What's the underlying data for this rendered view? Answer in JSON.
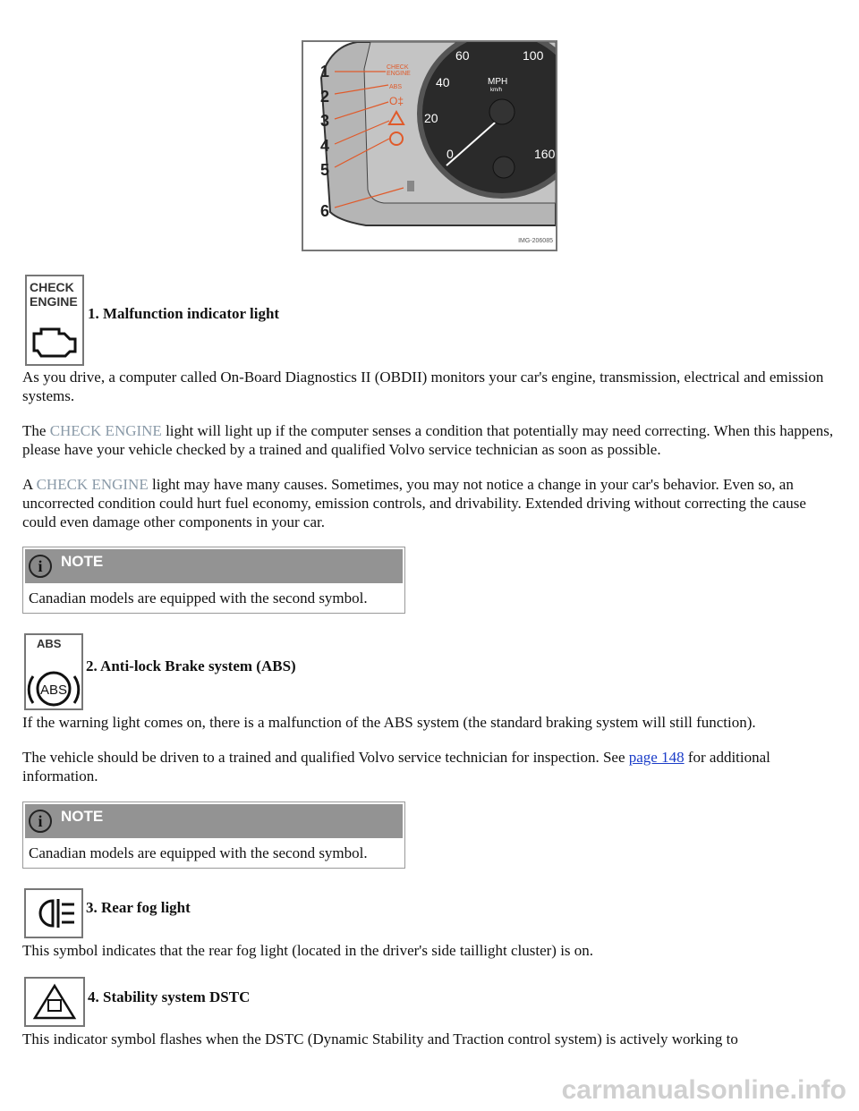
{
  "figure": {
    "callouts": [
      "1",
      "2",
      "3",
      "4",
      "5",
      "6"
    ],
    "image_code": "IMG-206085",
    "gauge_labels": [
      "60",
      "100",
      "40",
      "20",
      "0",
      "160",
      "MPH",
      "km/h"
    ]
  },
  "s1": {
    "icon_text": [
      "CHECK",
      "ENGINE"
    ],
    "heading": "1. Malfunction indicator light",
    "p1": "As you drive, a computer called On-Board Diagnostics II (OBDII) monitors your car's engine, transmission, electrical and emission systems.",
    "p2_a": "The ",
    "p2_hl": "CHECK ENGINE",
    "p2_b": " light will light up if the computer senses a condition that potentially may need correcting. When this happens, please have your vehicle checked by a trained and qualified Volvo service technician as soon as possible.",
    "p3_a": "A ",
    "p3_hl": "CHECK ENGINE",
    "p3_b": " light may have many causes. Sometimes, you may not notice a change in your car's behavior. Even so, an uncorrected condition could hurt fuel economy, emission controls, and drivability. Extended driving without correcting the cause could even damage other components in your car."
  },
  "note1": {
    "label": "NOTE",
    "text": "Canadian models are equipped with the second symbol."
  },
  "s2": {
    "icon_text": "ABS",
    "icon_inner": "ABS",
    "heading": "2. Anti-lock Brake system (ABS)",
    "p1": "If the warning light comes on, there is a malfunction of the ABS system (the standard braking system will still function).",
    "p2_a": "The vehicle should be driven to a trained and qualified Volvo service technician for inspection. See ",
    "p2_link": "page 148",
    "p2_b": " for additional information."
  },
  "note2": {
    "label": "NOTE",
    "text": "Canadian models are equipped with the second symbol."
  },
  "s3": {
    "heading": "3. Rear fog light",
    "p1": "This symbol indicates that the rear fog light (located in the driver's side taillight cluster) is on."
  },
  "s4": {
    "heading": "4. Stability system DSTC",
    "p1": "This indicator symbol flashes when the DSTC (Dynamic Stability and Traction control system) is actively working to"
  },
  "watermark": "carmanualsonline.info",
  "colors": {
    "highlight": "#8a9aa8",
    "link": "#1a3cc8",
    "warning": "#e05a2a"
  }
}
